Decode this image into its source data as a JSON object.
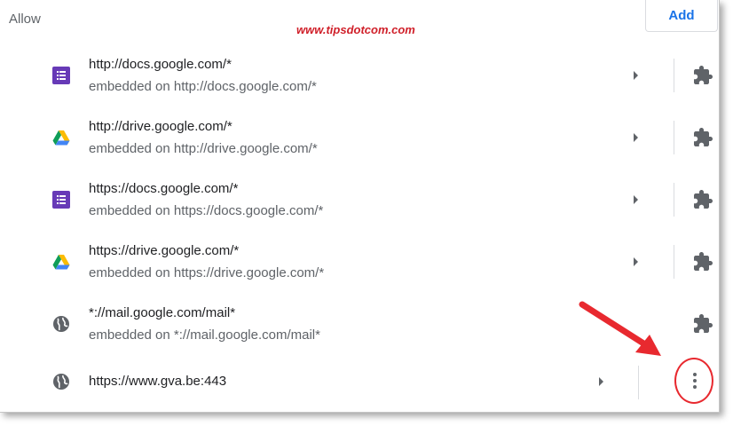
{
  "section": {
    "title": "Allow",
    "add_label": "Add"
  },
  "watermark": "www.tipsdotcom.com",
  "rows": [
    {
      "icon": "google-docs-icon",
      "site": "http://docs.google.com/*",
      "embedded": "embedded on http://docs.google.com/*",
      "has_arrow": true,
      "action_icon": "extension-puzzle-icon"
    },
    {
      "icon": "google-drive-icon",
      "site": "http://drive.google.com/*",
      "embedded": "embedded on http://drive.google.com/*",
      "has_arrow": true,
      "action_icon": "extension-puzzle-icon"
    },
    {
      "icon": "google-docs-icon",
      "site": "https://docs.google.com/*",
      "embedded": "embedded on https://docs.google.com/*",
      "has_arrow": true,
      "action_icon": "extension-puzzle-icon"
    },
    {
      "icon": "google-drive-icon",
      "site": "https://drive.google.com/*",
      "embedded": "embedded on https://drive.google.com/*",
      "has_arrow": true,
      "action_icon": "extension-puzzle-icon"
    },
    {
      "icon": "globe-icon",
      "site": "*://mail.google.com/mail*",
      "embedded": "embedded on *://mail.google.com/mail*",
      "has_arrow": false,
      "action_icon": "extension-puzzle-icon"
    },
    {
      "icon": "globe-icon",
      "site": "https://www.gva.be:443",
      "embedded": "",
      "has_arrow": true,
      "action_icon": "more-vert-icon"
    }
  ],
  "colors": {
    "accent": "#1a73e8",
    "docs_purple": "#673ab7",
    "annotation_red": "#e8292f"
  }
}
